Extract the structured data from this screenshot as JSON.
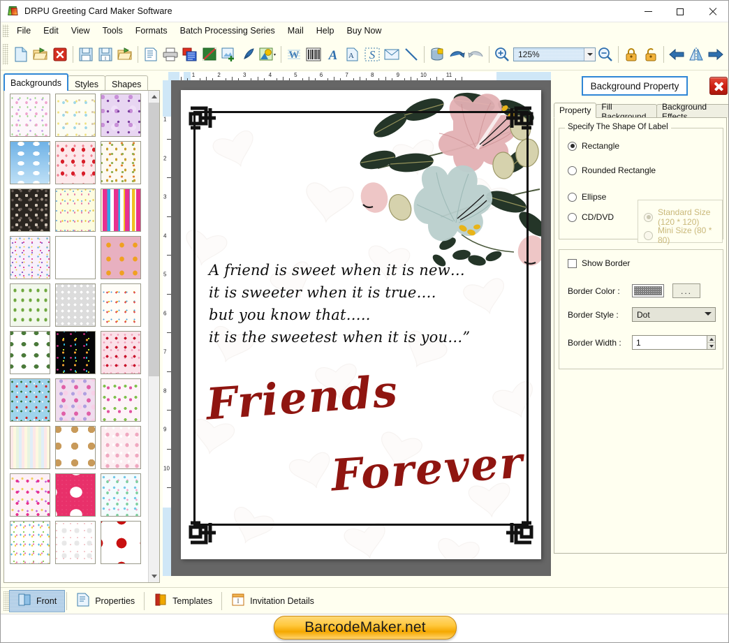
{
  "window": {
    "title": "DRPU Greeting Card Maker Software",
    "app_icon": "card-icon",
    "minimize": "—",
    "maximize": "□",
    "close": "✕"
  },
  "menu": {
    "items": [
      {
        "label": "File"
      },
      {
        "label": "Edit"
      },
      {
        "label": "View"
      },
      {
        "label": "Tools"
      },
      {
        "label": "Formats"
      },
      {
        "label": "Batch Processing Series"
      },
      {
        "label": "Mail"
      },
      {
        "label": "Help"
      },
      {
        "label": "Buy Now"
      }
    ]
  },
  "toolbar": {
    "buttons": [
      {
        "icon": "new-document-icon",
        "name": "new"
      },
      {
        "icon": "open-folder-icon",
        "name": "open"
      },
      {
        "icon": "close-red-x-icon",
        "name": "close"
      },
      {
        "icon": "save-floppy-icon",
        "name": "save"
      },
      {
        "icon": "save-as-floppy-icon",
        "name": "save-as"
      },
      {
        "icon": "export-folder-icon",
        "name": "export"
      },
      {
        "icon": "page-setup-icon",
        "name": "page-setup"
      },
      {
        "icon": "print-icon",
        "name": "print"
      },
      {
        "icon": "print-preview-icon",
        "name": "print-preview"
      },
      {
        "icon": "card-design-icon",
        "name": "design"
      },
      {
        "icon": "insert-image-icon",
        "name": "insert-image"
      },
      {
        "icon": "pen-draw-icon",
        "name": "draw"
      },
      {
        "icon": "shape-picture-icon",
        "name": "shape-picture"
      },
      {
        "icon": "watermark-w-icon",
        "name": "watermark"
      },
      {
        "icon": "barcode-icon",
        "name": "barcode"
      },
      {
        "icon": "text-a-icon",
        "name": "text"
      },
      {
        "icon": "text-page-icon",
        "name": "text-page"
      },
      {
        "icon": "signature-s-icon",
        "name": "signature"
      },
      {
        "icon": "envelope-icon",
        "name": "mail"
      },
      {
        "icon": "line-icon",
        "name": "line"
      },
      {
        "icon": "database-icon",
        "name": "database"
      },
      {
        "icon": "undo-icon",
        "name": "undo"
      },
      {
        "icon": "redo-icon",
        "name": "redo"
      },
      {
        "icon": "zoom-in-icon",
        "name": "zoom-in"
      },
      {
        "icon": "zoom-out-icon",
        "name": "zoom-out"
      },
      {
        "icon": "lock-closed-icon",
        "name": "lock"
      },
      {
        "icon": "lock-open-icon",
        "name": "unlock"
      },
      {
        "icon": "align-left-arrow-icon",
        "name": "align-left"
      },
      {
        "icon": "flip-horizontal-icon",
        "name": "flip-horizontal"
      },
      {
        "icon": "align-right-arrow-icon",
        "name": "align-right"
      },
      {
        "icon": "align-top-arrow-icon",
        "name": "align-top"
      },
      {
        "icon": "flip-vertical-icon",
        "name": "flip-vertical"
      },
      {
        "icon": "align-bottom-arrow-icon",
        "name": "align-bottom"
      }
    ],
    "zoom": {
      "value": "125%",
      "dropdown_icon": "chevron-down-icon"
    }
  },
  "left_panel": {
    "tabs": [
      {
        "label": "Backgrounds",
        "selected": true
      },
      {
        "label": "Styles",
        "selected": false
      },
      {
        "label": "Shapes",
        "selected": false
      }
    ],
    "scroll_up_icon": "chevron-up-icon",
    "scroll_down_icon": "chevron-down-icon",
    "thumbnails": [
      {
        "name": "baby-shower-pastel"
      },
      {
        "name": "baby-bottles-yellow"
      },
      {
        "name": "purple-floral-burst"
      },
      {
        "name": "blue-sky-clouds"
      },
      {
        "name": "red-strawberries"
      },
      {
        "name": "autumn-leaves-pattern"
      },
      {
        "name": "dark-stones-mosaic"
      },
      {
        "name": "cream-flower-strings"
      },
      {
        "name": "colorful-gift-boxes"
      },
      {
        "name": "mixed-flowers-bright"
      },
      {
        "name": "blue-snowflakes"
      },
      {
        "name": "mandala-circles-pink"
      },
      {
        "name": "green-pine-trees"
      },
      {
        "name": "white-heart-flowers"
      },
      {
        "name": "kids-celebration-white"
      },
      {
        "name": "green-leaf-necklace"
      },
      {
        "name": "fireworks-black"
      },
      {
        "name": "red-pink-hearts"
      },
      {
        "name": "santa-christmas-blue"
      },
      {
        "name": "pink-glitter-balls"
      },
      {
        "name": "pink-green-butterflies"
      },
      {
        "name": "pastel-stripes"
      },
      {
        "name": "teddy-bear-brown"
      },
      {
        "name": "pink-princess-dress"
      },
      {
        "name": "pink-balloon-hearts"
      },
      {
        "name": "heart-teddy-pink"
      },
      {
        "name": "easter-bunnies"
      },
      {
        "name": "rainbow-kids-fairies"
      },
      {
        "name": "white-heart-ribbons"
      },
      {
        "name": "red-hibiscus-flower"
      }
    ]
  },
  "canvas": {
    "ruler_horizontal": [
      "1",
      "2",
      "3",
      "4",
      "5",
      "6",
      "7",
      "8",
      "9",
      "10",
      "11"
    ],
    "ruler_vertical": [
      "1",
      "2",
      "3",
      "4",
      "5",
      "6",
      "7",
      "8",
      "9",
      "10"
    ],
    "card": {
      "poem_lines": [
        "A friend is sweet when it is new…",
        "it is sweeter when it is true….",
        "but you know that…..",
        "it is the sweetest when it is you…”"
      ],
      "headline_line1": "Friends",
      "headline_line2": "Forever",
      "headline_color": "#8f1510",
      "corner_ornament": "celtic-knot-icon",
      "floral_art": "watercolor-floral-icon"
    }
  },
  "right_panel": {
    "title": "Background Property",
    "close_icon": "close-icon",
    "tabs": [
      {
        "label": "Property",
        "selected": true
      },
      {
        "label": "Fill Background",
        "selected": false
      },
      {
        "label": "Background Effects",
        "selected": false
      }
    ],
    "shape_group": {
      "legend": "Specify The Shape Of Label",
      "options": [
        {
          "label": "Rectangle",
          "selected": true,
          "disabled": false
        },
        {
          "label": "Rounded Rectangle",
          "selected": false,
          "disabled": false
        },
        {
          "label": "Ellipse",
          "selected": false,
          "disabled": false
        },
        {
          "label": "CD/DVD",
          "selected": false,
          "disabled": false
        }
      ],
      "size_options": [
        {
          "label": "Standard Size (120 * 120)",
          "selected": true,
          "disabled": true
        },
        {
          "label": "Mini Size (80 * 80)",
          "selected": false,
          "disabled": true
        }
      ]
    },
    "border_group": {
      "show_border_label": "Show Border",
      "show_border_checked": false,
      "border_color_label": "Border Color :",
      "border_color_value": "#808080",
      "browse_button_label": "...",
      "border_style_label": "Border Style :",
      "border_style_value": "Dot",
      "border_width_label": "Border Width :",
      "border_width_value": "1"
    }
  },
  "bottom_bar": {
    "items": [
      {
        "label": "Front",
        "icon": "card-front-icon",
        "selected": true
      },
      {
        "label": "Properties",
        "icon": "properties-icon",
        "selected": false
      },
      {
        "label": "Templates",
        "icon": "templates-icon",
        "selected": false
      },
      {
        "label": "Invitation Details",
        "icon": "invitation-details-icon",
        "selected": false
      }
    ]
  },
  "watermark": {
    "text": "BarcodeMaker.net"
  }
}
